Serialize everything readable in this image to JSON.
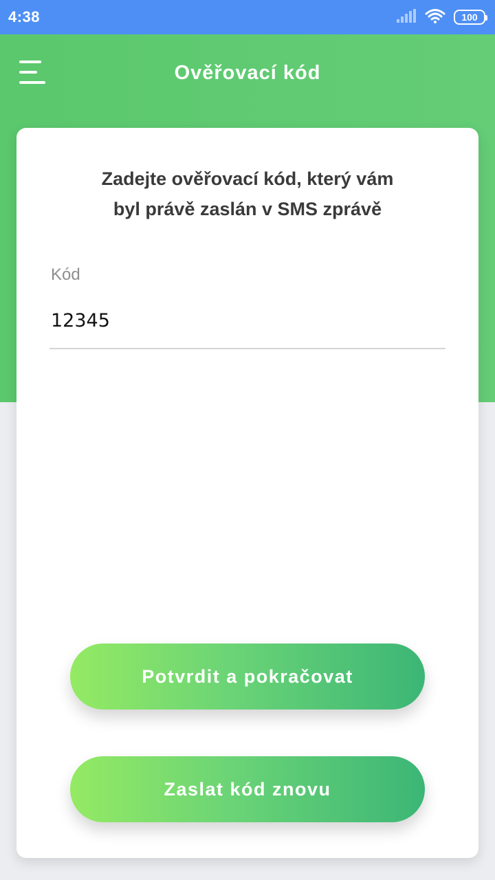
{
  "status_bar": {
    "time": "4:38",
    "battery": "100"
  },
  "app_bar": {
    "title": "Ověřovací kód"
  },
  "form": {
    "instruction": "Zadejte ověřovací kód, který vám\nbyl právě zaslán v SMS zprávě",
    "code_label": "Kód",
    "code_value": "12345"
  },
  "buttons": {
    "confirm_label": "Potvrdit a pokračovat",
    "resend_label": "Zaslat kód znovu"
  },
  "colors": {
    "status_bar": "#4e8ff5",
    "header_green": "#62cc74",
    "button_gradient_start": "#94ea63",
    "button_gradient_end": "#3cb676"
  },
  "icons": {
    "menu": "menu-icon",
    "signal": "signal-icon",
    "wifi": "wifi-icon",
    "battery": "battery-icon"
  }
}
